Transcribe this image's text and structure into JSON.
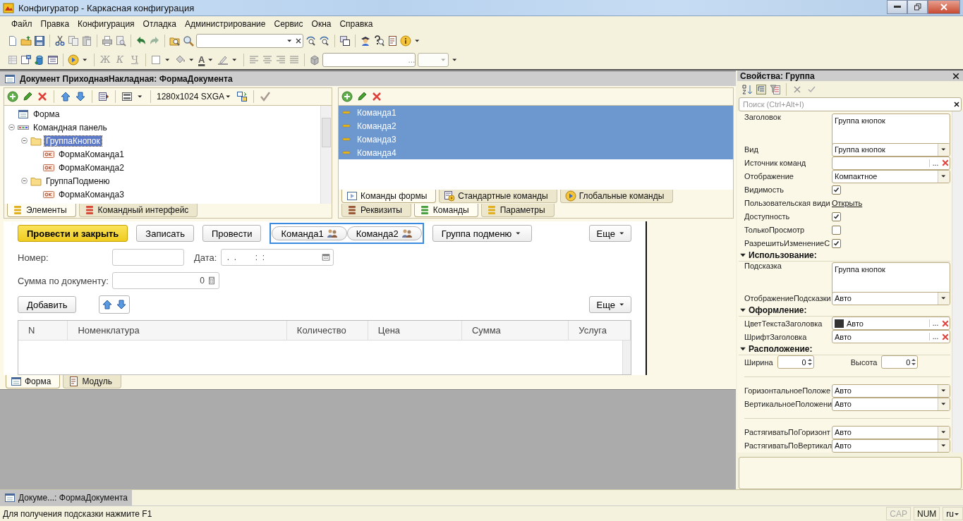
{
  "window": {
    "title": "Конфигуратор - Каркасная конфигурация"
  },
  "menu": [
    "Файл",
    "Правка",
    "Конфигурация",
    "Отладка",
    "Администрирование",
    "Сервис",
    "Окна",
    "Справка"
  ],
  "toolbar2": {
    "format_buttons": [
      "Ж",
      "К",
      "Ч"
    ],
    "font_color": "A",
    "field_button": "..."
  },
  "document": {
    "title": "Документ ПриходнаяНакладная: ФормаДокумента",
    "elements_panel": {
      "resolution": "1280x1024 SXGA",
      "tree": [
        {
          "label": "Форма",
          "kind": "form",
          "selected": false
        },
        {
          "label": "Командная панель",
          "kind": "panel",
          "selected": false,
          "expanded": true,
          "children": [
            {
              "label": "ГруппаКнопок",
              "kind": "group",
              "selected": true,
              "expanded": true,
              "children": [
                {
                  "label": "ФормаКоманда1",
                  "kind": "command",
                  "selected": false
                },
                {
                  "label": "ФормаКоманда2",
                  "kind": "command",
                  "selected": false
                }
              ]
            },
            {
              "label": "ГруппаПодменю",
              "kind": "group",
              "selected": false,
              "expanded": true,
              "children": [
                {
                  "label": "ФормаКоманда3",
                  "kind": "command",
                  "selected": false
                }
              ]
            }
          ]
        }
      ],
      "tabs": [
        {
          "label": "Элементы",
          "selected": true
        },
        {
          "label": "Командный интерфейс",
          "selected": false
        }
      ]
    },
    "commands_panel": {
      "items": [
        {
          "label": "Команда1",
          "selected": true
        },
        {
          "label": "Команда2",
          "selected": true
        },
        {
          "label": "Команда3",
          "selected": true
        },
        {
          "label": "Команда4",
          "selected": true
        }
      ],
      "tabs": [
        {
          "label": "Команды формы",
          "selected": true
        },
        {
          "label": "Стандартные команды",
          "selected": false
        },
        {
          "label": "Глобальные команды",
          "selected": false
        }
      ],
      "lower_tabs": [
        {
          "label": "Реквизиты",
          "selected": false
        },
        {
          "label": "Команды",
          "selected": true
        },
        {
          "label": "Параметры",
          "selected": false
        }
      ]
    },
    "form_preview": {
      "command_bar": [
        {
          "kind": "default",
          "label": "Провести и закрыть"
        },
        {
          "kind": "plain",
          "label": "Записать"
        },
        {
          "kind": "plain",
          "label": "Провести"
        },
        {
          "kind": "group",
          "items": [
            "Команда1",
            "Команда2"
          ]
        },
        {
          "kind": "menu",
          "label": "Группа подменю"
        },
        {
          "kind": "more",
          "label": "Еще"
        }
      ],
      "number": {
        "label": "Номер:"
      },
      "date": {
        "label": "Дата:",
        "value": " .  .        :  :"
      },
      "sum": {
        "label": "Сумма по документу:",
        "value": "0"
      },
      "table_bar": {
        "add": "Добавить",
        "more": "Еще"
      },
      "table": {
        "columns": [
          "N",
          "Номенклатура",
          "Количество",
          "Цена",
          "Сумма",
          "Услуга"
        ]
      }
    },
    "tabs": [
      {
        "label": "Форма",
        "selected": true
      },
      {
        "label": "Модуль",
        "selected": false
      }
    ]
  },
  "properties": {
    "title": "Свойства: Группа",
    "search": {
      "placeholder": "Поиск (Ctrl+Alt+I)"
    },
    "rows": [
      {
        "kind": "textarea",
        "label": "Заголовок",
        "value": "Группа кнопок"
      },
      {
        "kind": "select",
        "label": "Вид",
        "value": "Группа кнопок"
      },
      {
        "kind": "choice",
        "label": "Источник команд",
        "button": "..."
      },
      {
        "kind": "select",
        "label": "Отображение",
        "value": "Компактное"
      },
      {
        "kind": "checkbox",
        "label": "Видимость",
        "checked": true
      },
      {
        "kind": "link",
        "label": "Пользовательская види",
        "value": "Открыть"
      },
      {
        "kind": "checkbox",
        "label": "Доступность",
        "checked": true
      },
      {
        "kind": "checkbox",
        "label": "ТолькоПросмотр",
        "checked": false
      },
      {
        "kind": "checkbox",
        "label": "РазрешитьИзменениеС",
        "checked": true
      },
      {
        "kind": "section",
        "label": "Использование:"
      },
      {
        "kind": "textarea",
        "label": "Подсказка",
        "value": "Группа кнопок"
      },
      {
        "kind": "select",
        "label": "ОтображениеПодсказки",
        "value": "Авто"
      },
      {
        "kind": "section",
        "label": "Оформление:"
      },
      {
        "kind": "color",
        "label": "ЦветТекстаЗаголовка",
        "value": "Авто",
        "button": "..."
      },
      {
        "kind": "choice",
        "label": "ШрифтЗаголовка",
        "value": "Авто",
        "button": "..."
      },
      {
        "kind": "section",
        "label": "Расположение:"
      },
      {
        "kind": "size",
        "label": "Ширина",
        "value": "0",
        "label2": "Высота",
        "value2": "0"
      },
      {
        "kind": "separator"
      },
      {
        "kind": "select",
        "label": "ГоризонтальноеПоложе",
        "value": "Авто"
      },
      {
        "kind": "select",
        "label": "ВертикальноеПоложени",
        "value": "Авто"
      },
      {
        "kind": "separator"
      },
      {
        "kind": "select",
        "label": "РастягиватьПоГоризонт",
        "value": "Авто"
      },
      {
        "kind": "select",
        "label": "РастягиватьПоВертикал",
        "value": "Авто"
      }
    ]
  },
  "window_tabs": [
    {
      "label": "Докуме...: ФормаДокумента",
      "selected": true
    }
  ],
  "status_bar": {
    "hint": "Для получения подсказки нажмите F1",
    "indicators": [
      {
        "label": "CAP",
        "on": false
      },
      {
        "label": "NUM",
        "on": true
      }
    ],
    "language": "ru"
  }
}
